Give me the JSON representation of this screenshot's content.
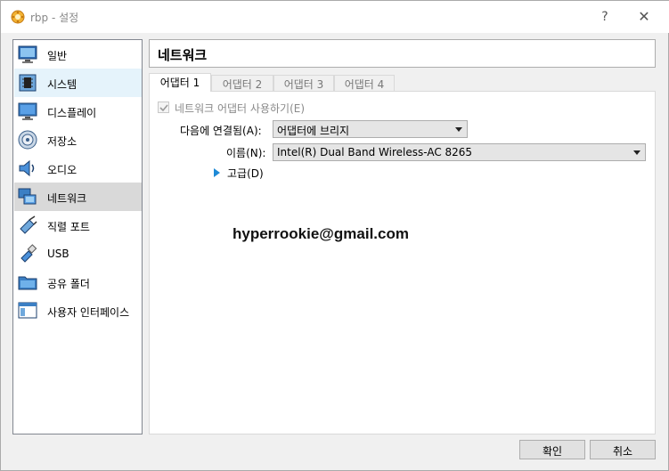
{
  "window": {
    "title": "rbp - 설정",
    "help": "?",
    "close": "✕"
  },
  "sidebar": {
    "items": [
      {
        "label": "일반",
        "icon": "monitor-icon"
      },
      {
        "label": "시스템",
        "icon": "chip-icon"
      },
      {
        "label": "디스플레이",
        "icon": "display-icon"
      },
      {
        "label": "저장소",
        "icon": "disk-icon"
      },
      {
        "label": "오디오",
        "icon": "speaker-icon"
      },
      {
        "label": "네트워크",
        "icon": "network-icon"
      },
      {
        "label": "직렬 포트",
        "icon": "serial-port-icon"
      },
      {
        "label": "USB",
        "icon": "usb-icon"
      },
      {
        "label": "공유 폴더",
        "icon": "folder-icon"
      },
      {
        "label": "사용자 인터페이스",
        "icon": "ui-window-icon"
      }
    ],
    "hovered": "시스템",
    "selected": "네트워크"
  },
  "page": {
    "title": "네트워크"
  },
  "tabs": [
    {
      "label": "어댑터 1"
    },
    {
      "label": "어댑터 2"
    },
    {
      "label": "어댑터 3"
    },
    {
      "label": "어댑터 4"
    }
  ],
  "active_tab": "어댑터 1",
  "adapter": {
    "enable_label": "네트워크 어댑터 사용하기(E)",
    "enable_checked": true,
    "attached_label": "다음에 연결됨(A):",
    "attached_value": "어댑터에 브리지",
    "name_label": "이름(N):",
    "name_value": "Intel(R) Dual Band Wireless-AC 8265",
    "advanced_label": "고급(D)"
  },
  "watermark": "hyperrookie@gmail.com",
  "buttons": {
    "ok": "확인",
    "cancel": "취소"
  },
  "colors": {
    "accent": "#1e8ad6",
    "selected_bg": "#d9d9d9",
    "hover_bg": "#e5f3fb"
  }
}
